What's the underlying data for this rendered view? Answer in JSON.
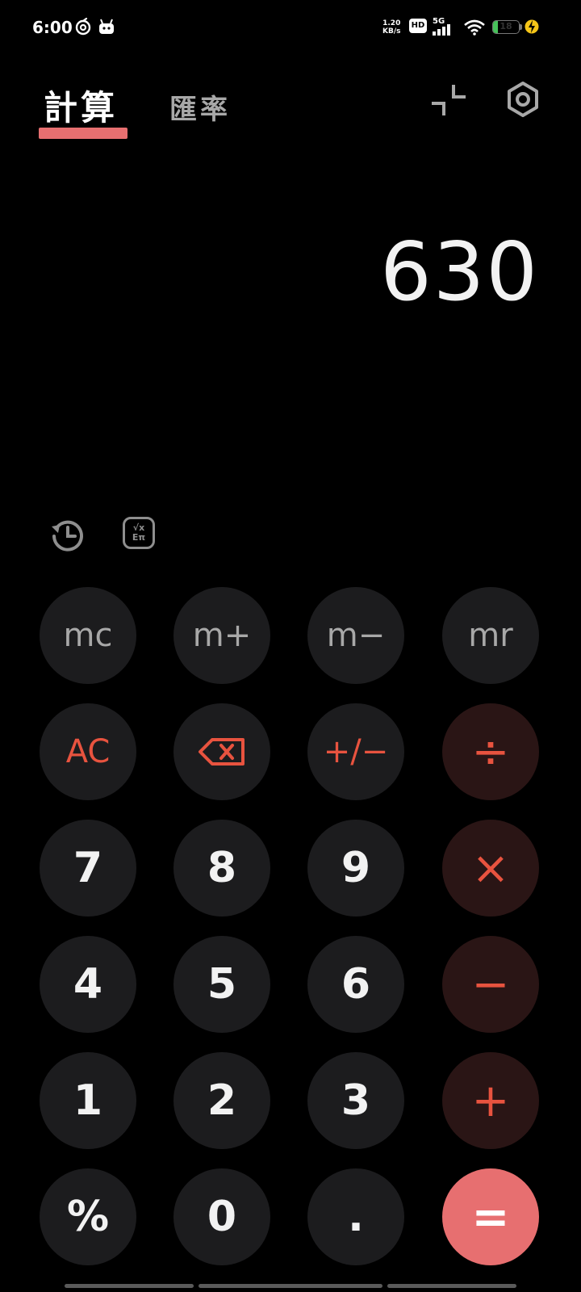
{
  "status_bar": {
    "time": "6:00",
    "net_speed_value": "1.20",
    "net_speed_unit": "KB/s",
    "hd_badge": "HD",
    "network_type": "5G",
    "battery_level": "18",
    "battery_fraction": 0.18,
    "battery_color": "#47c15a"
  },
  "header": {
    "tabs": [
      {
        "label": "計算",
        "active": true
      },
      {
        "label": "匯率",
        "active": false
      }
    ],
    "accent_color": "#e76f70",
    "icons": [
      "collapse-icon",
      "settings-icon"
    ]
  },
  "display": {
    "value": "630"
  },
  "tools": {
    "icons": [
      "history-icon",
      "scientific-mode-icon"
    ],
    "scientific_symbols": [
      "√x",
      "Eπ"
    ]
  },
  "keypad": {
    "rows": [
      [
        "mc",
        "m+",
        "m−",
        "mr"
      ],
      [
        "AC",
        "⌫",
        "+/−",
        "÷"
      ],
      [
        "7",
        "8",
        "9",
        "×"
      ],
      [
        "4",
        "5",
        "6",
        "−"
      ],
      [
        "1",
        "2",
        "3",
        "+"
      ],
      [
        "%",
        "0",
        ".",
        "="
      ]
    ],
    "operator_color": "#e8533f",
    "equals_color": "#e76f70"
  }
}
